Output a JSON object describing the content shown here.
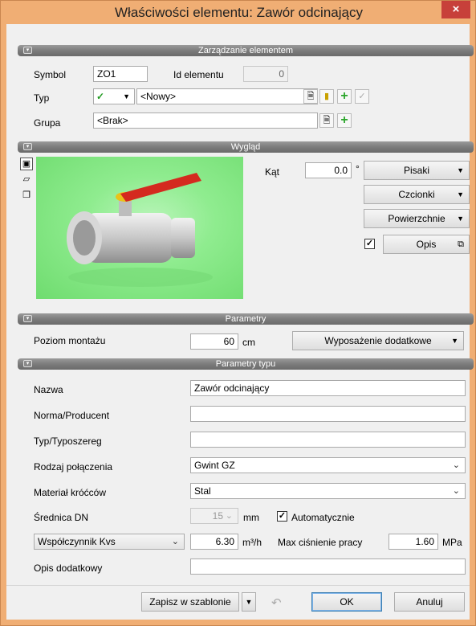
{
  "window": {
    "title": "Właściwości elementu: Zawór odcinający",
    "close_glyph": "×"
  },
  "sections": {
    "management": "Zarządzanie elementem",
    "appearance": "Wygląd",
    "parameters": "Parametry",
    "type_parameters": "Parametry typu"
  },
  "management": {
    "symbol_label": "Symbol",
    "symbol_value": "ZO1",
    "id_label": "Id elementu",
    "id_value": "0",
    "type_label": "Typ",
    "type_value": "<Nowy>",
    "group_label": "Grupa",
    "group_value": "<Brak>"
  },
  "appearance": {
    "angle_label": "Kąt",
    "angle_value": "0.0",
    "angle_unit": "°",
    "pens_label": "Pisaki",
    "fonts_label": "Czcionki",
    "surfaces_label": "Powierzchnie",
    "description_label": "Opis",
    "description_checked": true
  },
  "parameters": {
    "mount_level_label": "Poziom montażu",
    "mount_level_value": "60",
    "mount_level_unit": "cm",
    "extra_equipment_label": "Wyposażenie dodatkowe"
  },
  "type_params": {
    "name_label": "Nazwa",
    "name_value": "Zawór odcinający",
    "norm_label": "Norma/Producent",
    "norm_value": "",
    "series_label": "Typ/Typoszereg",
    "series_value": "",
    "connection_label": "Rodzaj połączenia",
    "connection_value": "Gwint GZ",
    "material_label": "Materiał króćców",
    "material_value": "Stal",
    "dn_label": "Średnica DN",
    "dn_value": "15",
    "dn_unit": "mm",
    "auto_label": "Automatycznie",
    "auto_checked": true,
    "coef_select": "Współczynnik Kvs",
    "coef_value": "6.30",
    "coef_unit": "m³/h",
    "max_pressure_label": "Max ciśnienie pracy",
    "max_pressure_value": "1.60",
    "max_pressure_unit": "MPa",
    "extra_desc_label": "Opis dodatkowy",
    "extra_desc_value": ""
  },
  "footer": {
    "save_template_label": "Zapisz w szablonie",
    "ok_label": "OK",
    "cancel_label": "Anuluj"
  },
  "colors": {
    "title_bar": "#f0ae74",
    "close_button": "#c7403a",
    "section_bar": "#7c7c7c",
    "preview_background": "#8fec8f",
    "valve_handle": "#d42a1f",
    "add_icon": "#2aa52a"
  }
}
